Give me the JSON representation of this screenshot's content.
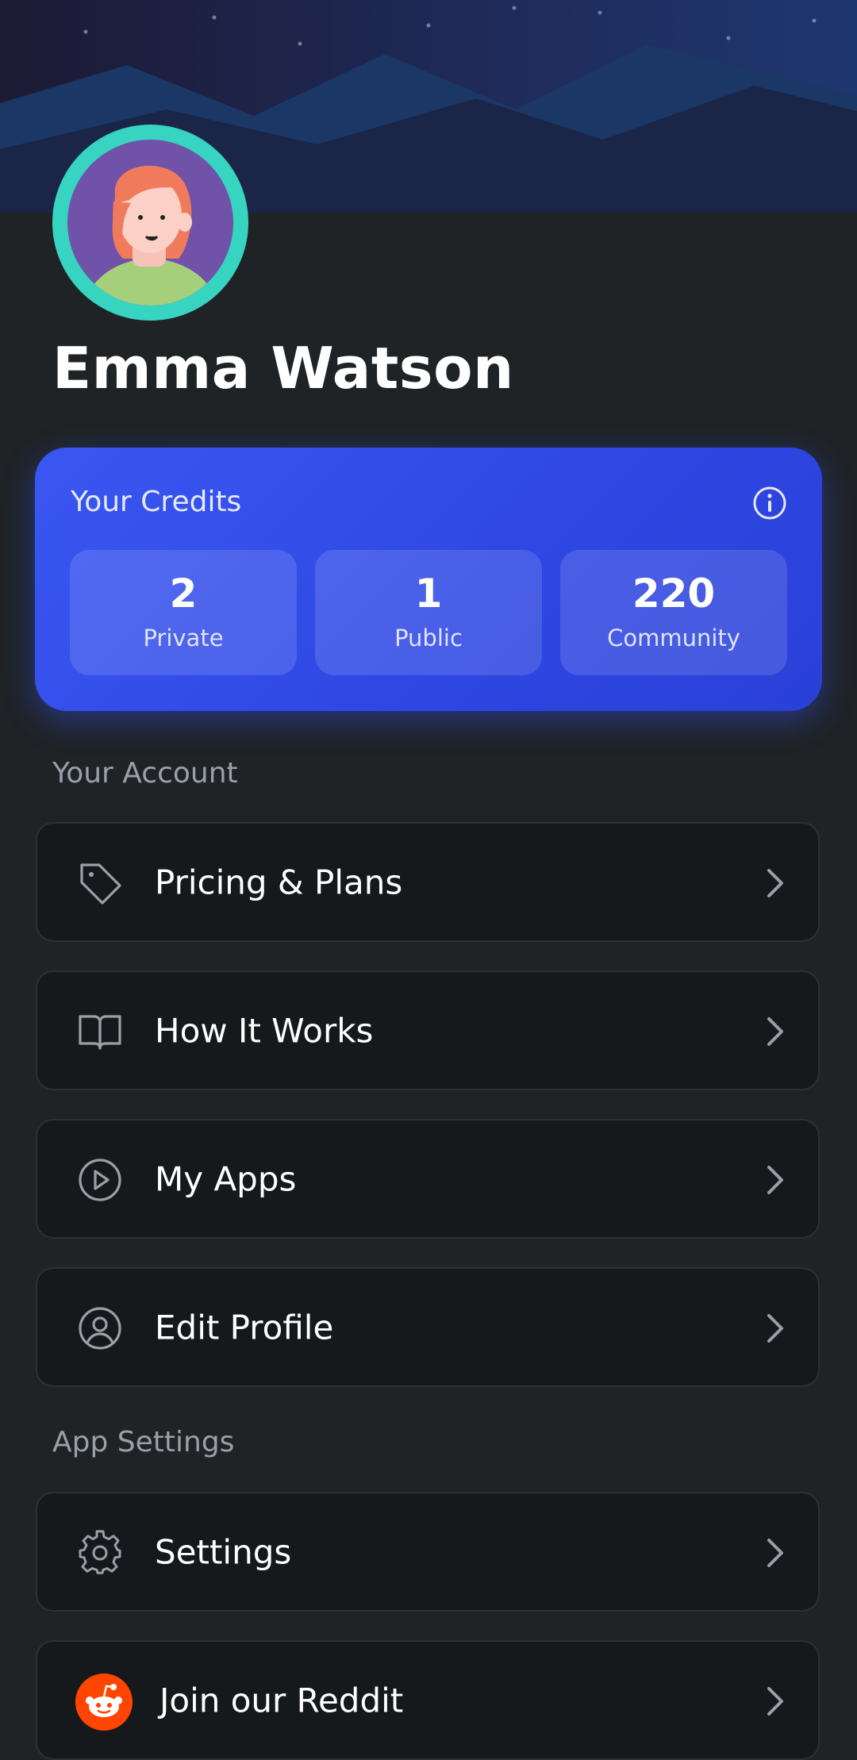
{
  "profile": {
    "name": "Emma Watson"
  },
  "credits": {
    "title": "Your Credits",
    "stats": [
      {
        "value": "2",
        "label": "Private"
      },
      {
        "value": "1",
        "label": "Public"
      },
      {
        "value": "220",
        "label": "Community"
      }
    ]
  },
  "account": {
    "section_label": "Your Account",
    "items": [
      {
        "label": "Pricing & Plans",
        "icon": "tag-icon"
      },
      {
        "label": "How It Works",
        "icon": "book-icon"
      },
      {
        "label": "My Apps",
        "icon": "play-circle-icon"
      },
      {
        "label": "Edit Profile",
        "icon": "user-circle-icon"
      }
    ]
  },
  "app_settings": {
    "section_label": "App Settings",
    "items": [
      {
        "label": "Settings",
        "icon": "gear-icon"
      },
      {
        "label": "Join our Reddit",
        "icon": "reddit-icon"
      }
    ]
  },
  "colors": {
    "accent": "#3551ee",
    "avatar_ring": "#37d4c2",
    "reddit": "#ff4500",
    "background": "#1f2326"
  }
}
